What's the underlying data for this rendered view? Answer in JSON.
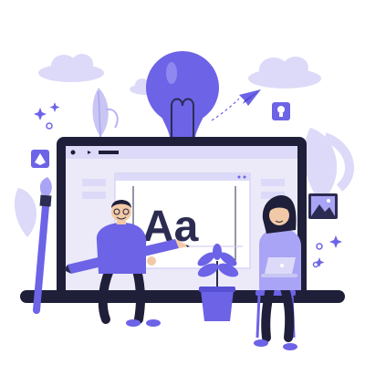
{
  "illustration": {
    "glyph_text": "Aa"
  },
  "colors": {
    "accent": "#6c63e6",
    "accent_light": "#a9a4f5",
    "accent_pale": "#dcdaf8",
    "dark": "#2c2c52",
    "screen_bg": "#eceaf8",
    "frame": "#1f1f3a",
    "cloud": "#dcdaf8",
    "leaf": "#c9c6f3",
    "skin": "#f2c9a6"
  },
  "icons": [
    "lightbulb-icon",
    "paper-plane-icon",
    "pen-nib-icon",
    "image-icon",
    "bulb-badge-icon",
    "paint-brush-icon",
    "pencil-icon",
    "laptop-icon",
    "potted-plant-icon",
    "sparkle-icon",
    "cloud-icon"
  ]
}
